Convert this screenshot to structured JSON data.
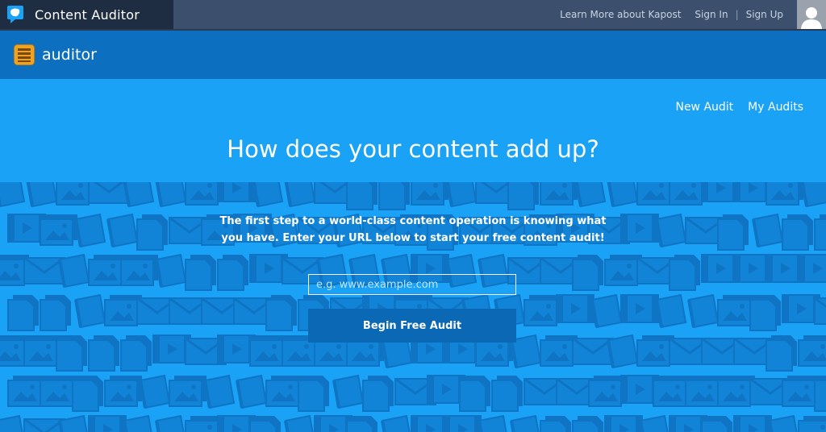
{
  "topbar": {
    "brand_title": "Content Auditor",
    "brand_icon": "speech-bubble-icon",
    "nav": {
      "learn_more": "Learn More about Kapost",
      "sign_in": "Sign In",
      "separator": "|",
      "sign_up": "Sign Up"
    },
    "avatar_icon": "user-silhouette-icon"
  },
  "app_header": {
    "title": "auditor",
    "icon": "list-icon"
  },
  "main": {
    "subnav": {
      "new_audit": "New Audit",
      "my_audits": "My Audits"
    },
    "headline": "How does your content add up?",
    "intro": "The first step to a world-class content operation is knowing what you have. Enter your URL below to start your free content audit!",
    "url_input": {
      "value": "",
      "placeholder": "e.g. www.example.com"
    },
    "begin_button": "Begin Free Audit",
    "background_icons": [
      "image-icon",
      "envelope-icon",
      "book-icon",
      "document-icon",
      "video-icon"
    ]
  },
  "colors": {
    "topbar": "#3c4f6c",
    "brand_bg": "#1f2d42",
    "app_header": "#0d6fc0",
    "main_bg": "#19a2f6",
    "button": "#0b68b5",
    "pattern": "#1284d8"
  }
}
